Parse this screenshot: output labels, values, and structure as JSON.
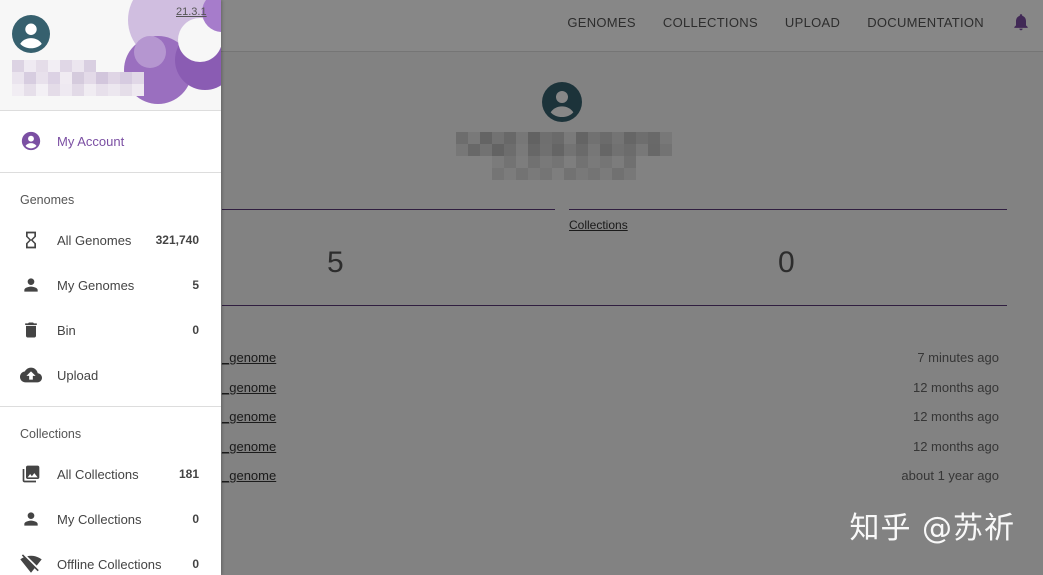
{
  "version": "21.3.1",
  "topnav": [
    "GENOMES",
    "COLLECTIONS",
    "UPLOAD",
    "DOCUMENTATION"
  ],
  "colors": {
    "accent": "#7b4fa3",
    "avatar": "#36606e",
    "rule": "#5b3a7a",
    "icon": "#444444"
  },
  "drawer": {
    "account_label": "My Account",
    "genomes_section": "Genomes",
    "genomes_items": [
      {
        "label": "All Genomes",
        "count": "321,740",
        "icon": "hourglass-icon"
      },
      {
        "label": "My Genomes",
        "count": "5",
        "icon": "person-icon"
      },
      {
        "label": "Bin",
        "count": "0",
        "icon": "trash-icon"
      },
      {
        "label": "Upload",
        "count": "",
        "icon": "cloud-upload-icon"
      }
    ],
    "collections_section": "Collections",
    "collections_items": [
      {
        "label": "All Collections",
        "count": "181",
        "icon": "photo-library-icon"
      },
      {
        "label": "My Collections",
        "count": "0",
        "icon": "person-icon"
      },
      {
        "label": "Offline Collections",
        "count": "0",
        "icon": "wifi-off-icon"
      }
    ]
  },
  "main": {
    "stats": [
      {
        "label": "",
        "value": "5"
      },
      {
        "label": "Collections",
        "value": "0"
      }
    ],
    "recent": [
      {
        "name": "_genome",
        "time": "7 minutes ago"
      },
      {
        "name": "_genome",
        "time": "12 months ago"
      },
      {
        "name": "_genome",
        "time": "12 months ago"
      },
      {
        "name": "_genome",
        "time": "12 months ago"
      },
      {
        "name": "_genome",
        "time": "about 1 year ago"
      }
    ]
  },
  "watermark": "知乎 @苏祈"
}
